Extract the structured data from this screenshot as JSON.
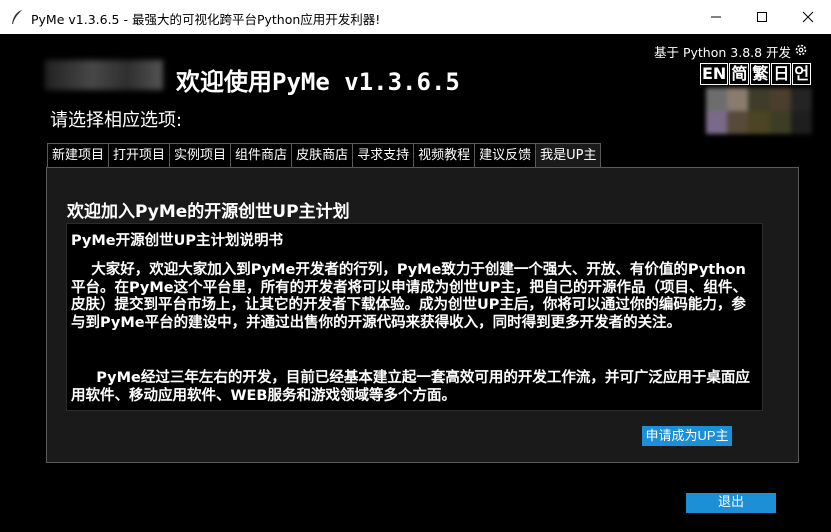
{
  "window": {
    "title": "PyMe v1.3.6.5 -  最强大的可视化跨平台Python应用开发利器!"
  },
  "header": {
    "welcome": "欢迎使用PyMe v1.3.6.5",
    "choose_prompt": "请选择相应选项:",
    "python_version": "基于 Python 3.8.8 开发",
    "languages": [
      "EN",
      "简",
      "繁",
      "日",
      "언"
    ]
  },
  "tabs": [
    {
      "label": "新建项目"
    },
    {
      "label": "打开项目"
    },
    {
      "label": "实例项目"
    },
    {
      "label": "组件商店"
    },
    {
      "label": "皮肤商店"
    },
    {
      "label": "寻求支持"
    },
    {
      "label": "视频教程"
    },
    {
      "label": "建议反馈"
    },
    {
      "label": "我是UP主"
    }
  ],
  "active_tab": "我是UP主",
  "panel": {
    "title": "欢迎加入PyMe的开源创世UP主计划",
    "doc_title": "PyMe开源创世UP主计划说明书",
    "paragraph1": "    大家好，欢迎大家加入到PyMe开发者的行列，PyMe致力于创建一个强大、开放、有价值的Python平台。在PyMe这个平台里，所有的开发者将可以申请成为创世UP主，把自己的开源作品（项目、组件、皮肤）提交到平台市场上，让其它的开发者下载体验。成为创世UP主后，你将可以通过你的编码能力，参与到PyMe平台的建设中，并通过出售你的开源代码来获得收入，同时得到更多开发者的关注。",
    "paragraph2": "     PyMe经过三年左右的开发，目前已经基本建立起一套高效可用的开发工作流，并可广泛应用于桌面应用软件、移动应用软件、WEB服务和游戏领域等多个方面。",
    "apply_button": "申请成为UP主"
  },
  "footer": {
    "exit_button": "退出"
  },
  "colors": {
    "accent_button": "#1d8fd6",
    "background": "#000000",
    "panel": "#1a1a1a"
  }
}
